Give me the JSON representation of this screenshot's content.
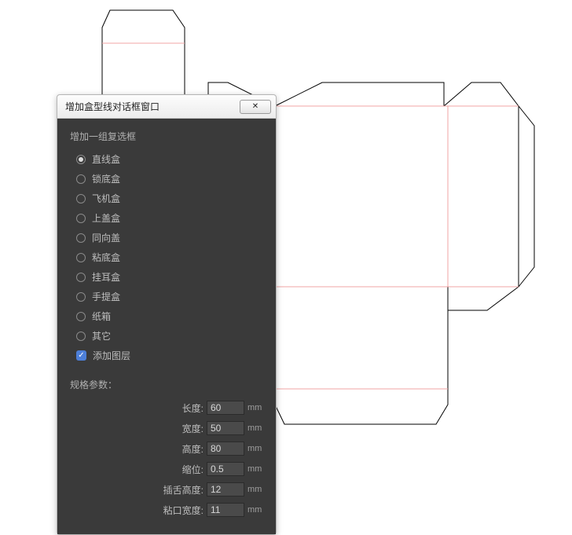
{
  "dialog": {
    "title": "增加盒型线对话框窗口",
    "close_label": "✕"
  },
  "group": {
    "title": "增加一组复选框",
    "options": [
      {
        "label": "直线盒",
        "checked": true
      },
      {
        "label": "锁底盒",
        "checked": false
      },
      {
        "label": "飞机盒",
        "checked": false
      },
      {
        "label": "上盖盒",
        "checked": false
      },
      {
        "label": "同向盖",
        "checked": false
      },
      {
        "label": "粘底盒",
        "checked": false
      },
      {
        "label": "挂耳盒",
        "checked": false
      },
      {
        "label": "手提盒",
        "checked": false
      },
      {
        "label": "纸箱",
        "checked": false
      },
      {
        "label": "其它",
        "checked": false
      }
    ],
    "add_layer": {
      "label": "添加图层",
      "checked": true
    }
  },
  "params": {
    "title": "规格参数：",
    "rows": [
      {
        "label": "长度:",
        "value": "60",
        "unit": "mm"
      },
      {
        "label": "宽度:",
        "value": "50",
        "unit": "mm"
      },
      {
        "label": "高度:",
        "value": "80",
        "unit": "mm"
      },
      {
        "label": "缩位:",
        "value": "0.5",
        "unit": "mm"
      },
      {
        "label": "插舌高度:",
        "value": "12",
        "unit": "mm"
      },
      {
        "label": "粘口宽度:",
        "value": "11",
        "unit": "mm"
      }
    ]
  },
  "colors": {
    "fold": "#f0a4a4",
    "cut": "#000000"
  }
}
